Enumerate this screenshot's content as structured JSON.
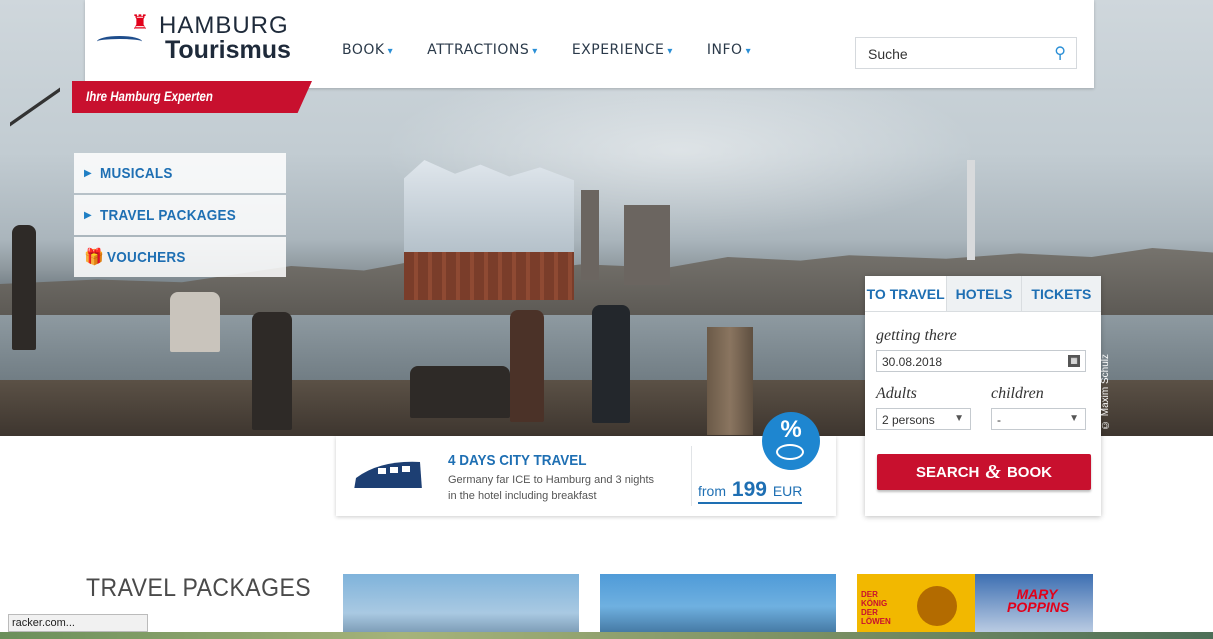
{
  "header": {
    "logo_line1": "HAMBURG",
    "logo_line2": "Tourismus",
    "nav": [
      {
        "label": "BOOK"
      },
      {
        "label": "ATTRACTIONS"
      },
      {
        "label": "EXPERIENCE"
      },
      {
        "label": "INFO"
      }
    ],
    "search_placeholder": "Suche",
    "ribbon": "Ihre Hamburg Experten"
  },
  "side_menu": [
    {
      "label": "MUSICALS"
    },
    {
      "label": "TRAVEL PACKAGES"
    },
    {
      "label": "VOUCHERS"
    }
  ],
  "booking": {
    "tabs": [
      "TO TRAVEL",
      "HOTELS",
      "TICKETS"
    ],
    "getting_there_label": "getting there",
    "date_value": "30.08.2018",
    "adults_label": "Adults",
    "children_label": "children",
    "adults_value": "2 persons",
    "children_value": "-",
    "button_pre": "SEARCH",
    "button_amp": "&",
    "button_post": "BOOK"
  },
  "promo": {
    "title": "4 DAYS CITY TRAVEL",
    "desc_line1": "Germany far ICE to Hamburg and 3 nights",
    "desc_line2": "in the hotel including breakfast",
    "price_prefix": "from",
    "price_value": "199",
    "price_currency": "EUR",
    "badge": "%"
  },
  "photo_credit": "© Maxim Schulz",
  "bottom": {
    "section_title": "TRAVEL PACKAGES",
    "card3_left": "DER KÖNIG DER LÖWEN",
    "card3_right": "MARY POPPINS"
  },
  "statusbar": "racker.com...",
  "colors": {
    "brand_red": "#c8102e",
    "brand_blue": "#1e6fb3",
    "accent_blue": "#2a8fd6"
  }
}
